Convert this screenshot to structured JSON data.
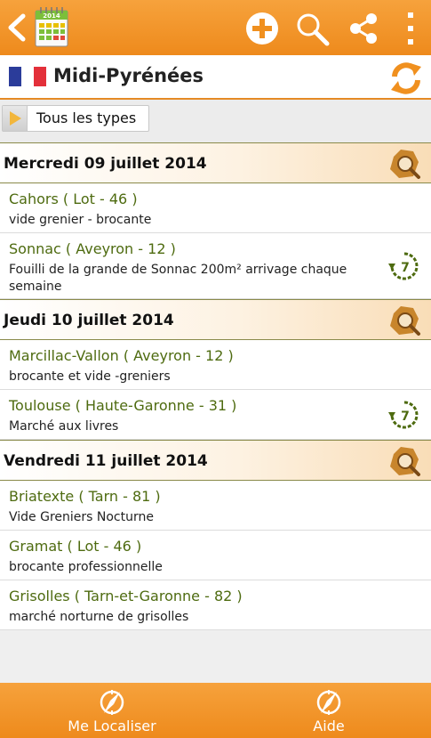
{
  "actionbar": {
    "logo_year": "2014",
    "icons": [
      "back-icon",
      "calendar-logo-icon",
      "add-icon",
      "search-icon",
      "share-icon",
      "more-icon"
    ]
  },
  "region": {
    "title": "Midi-Pyrénées",
    "flag_colors": [
      "#2b3c9a",
      "#ffffff",
      "#e3303a"
    ],
    "refresh_icon": "refresh-icon"
  },
  "filter": {
    "label": "Tous les types"
  },
  "days": [
    {
      "label": "Mercredi 09 juillet 2014",
      "events": [
        {
          "title": "Cahors ( Lot - 46 )",
          "desc": "vide grenier - brocante",
          "weekly": false
        },
        {
          "title": "Sonnac ( Aveyron - 12 )",
          "desc": "Fouilli de la grande de Sonnac 200m² arrivage chaque semaine",
          "weekly": true
        }
      ]
    },
    {
      "label": "Jeudi 10 juillet 2014",
      "events": [
        {
          "title": "Marcillac-Vallon ( Aveyron - 12 )",
          "desc": "brocante et vide -greniers",
          "weekly": false
        },
        {
          "title": "Toulouse ( Haute-Garonne - 31 )",
          "desc": "Marché aux livres",
          "weekly": true
        }
      ]
    },
    {
      "label": "Vendredi 11 juillet 2014",
      "events": [
        {
          "title": "Briatexte ( Tarn - 81 )",
          "desc": "Vide Greniers Nocturne",
          "weekly": false
        },
        {
          "title": "Gramat ( Lot - 46 )",
          "desc": "brocante professionnelle",
          "weekly": false
        },
        {
          "title": "Grisolles ( Tarn-et-Garonne - 82 )",
          "desc": "marché norturne de grisolles",
          "weekly": false
        }
      ]
    }
  ],
  "weekly_badge": "7",
  "bottom": {
    "locate_label": "Me Localiser",
    "help_label": "Aide"
  },
  "colors": {
    "accent": "#f0901f",
    "event_title": "#4e6b10"
  }
}
